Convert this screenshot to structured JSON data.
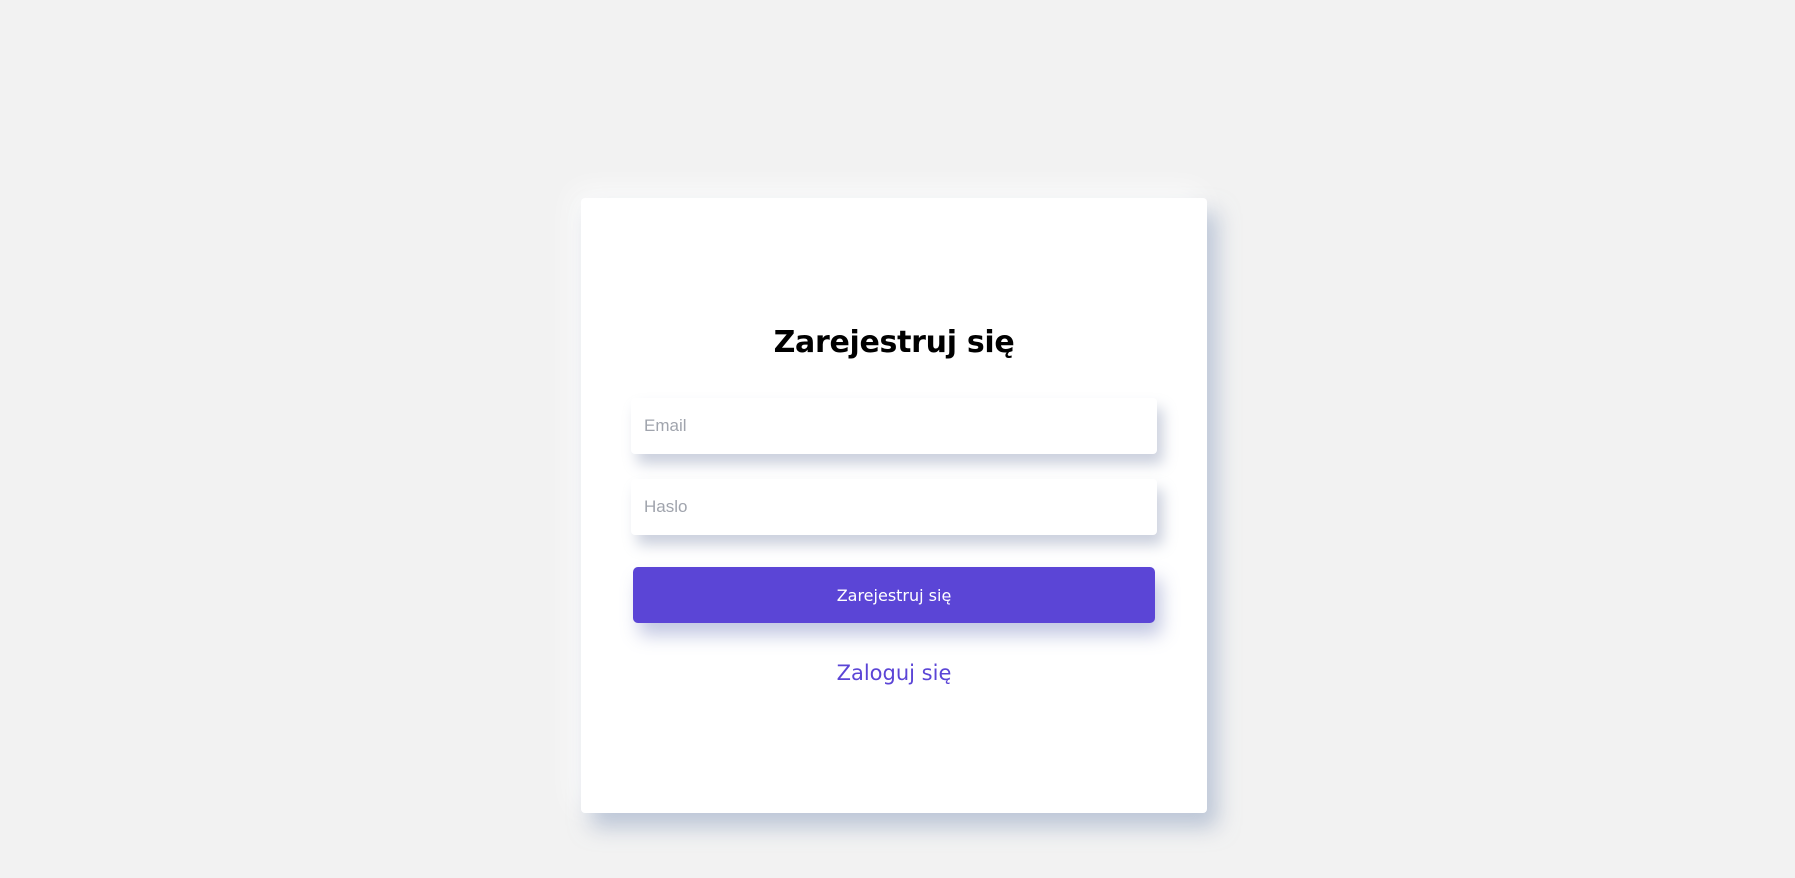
{
  "form": {
    "title": "Zarejestruj się",
    "email_placeholder": "Email",
    "password_placeholder": "Haslo",
    "submit_label": "Zarejestruj się",
    "login_link": "Zaloguj się"
  },
  "colors": {
    "background": "#f2f2f2",
    "card": "#ffffff",
    "accent": "#5b45d6",
    "title": "#000000",
    "placeholder": "#a0a4ad"
  }
}
